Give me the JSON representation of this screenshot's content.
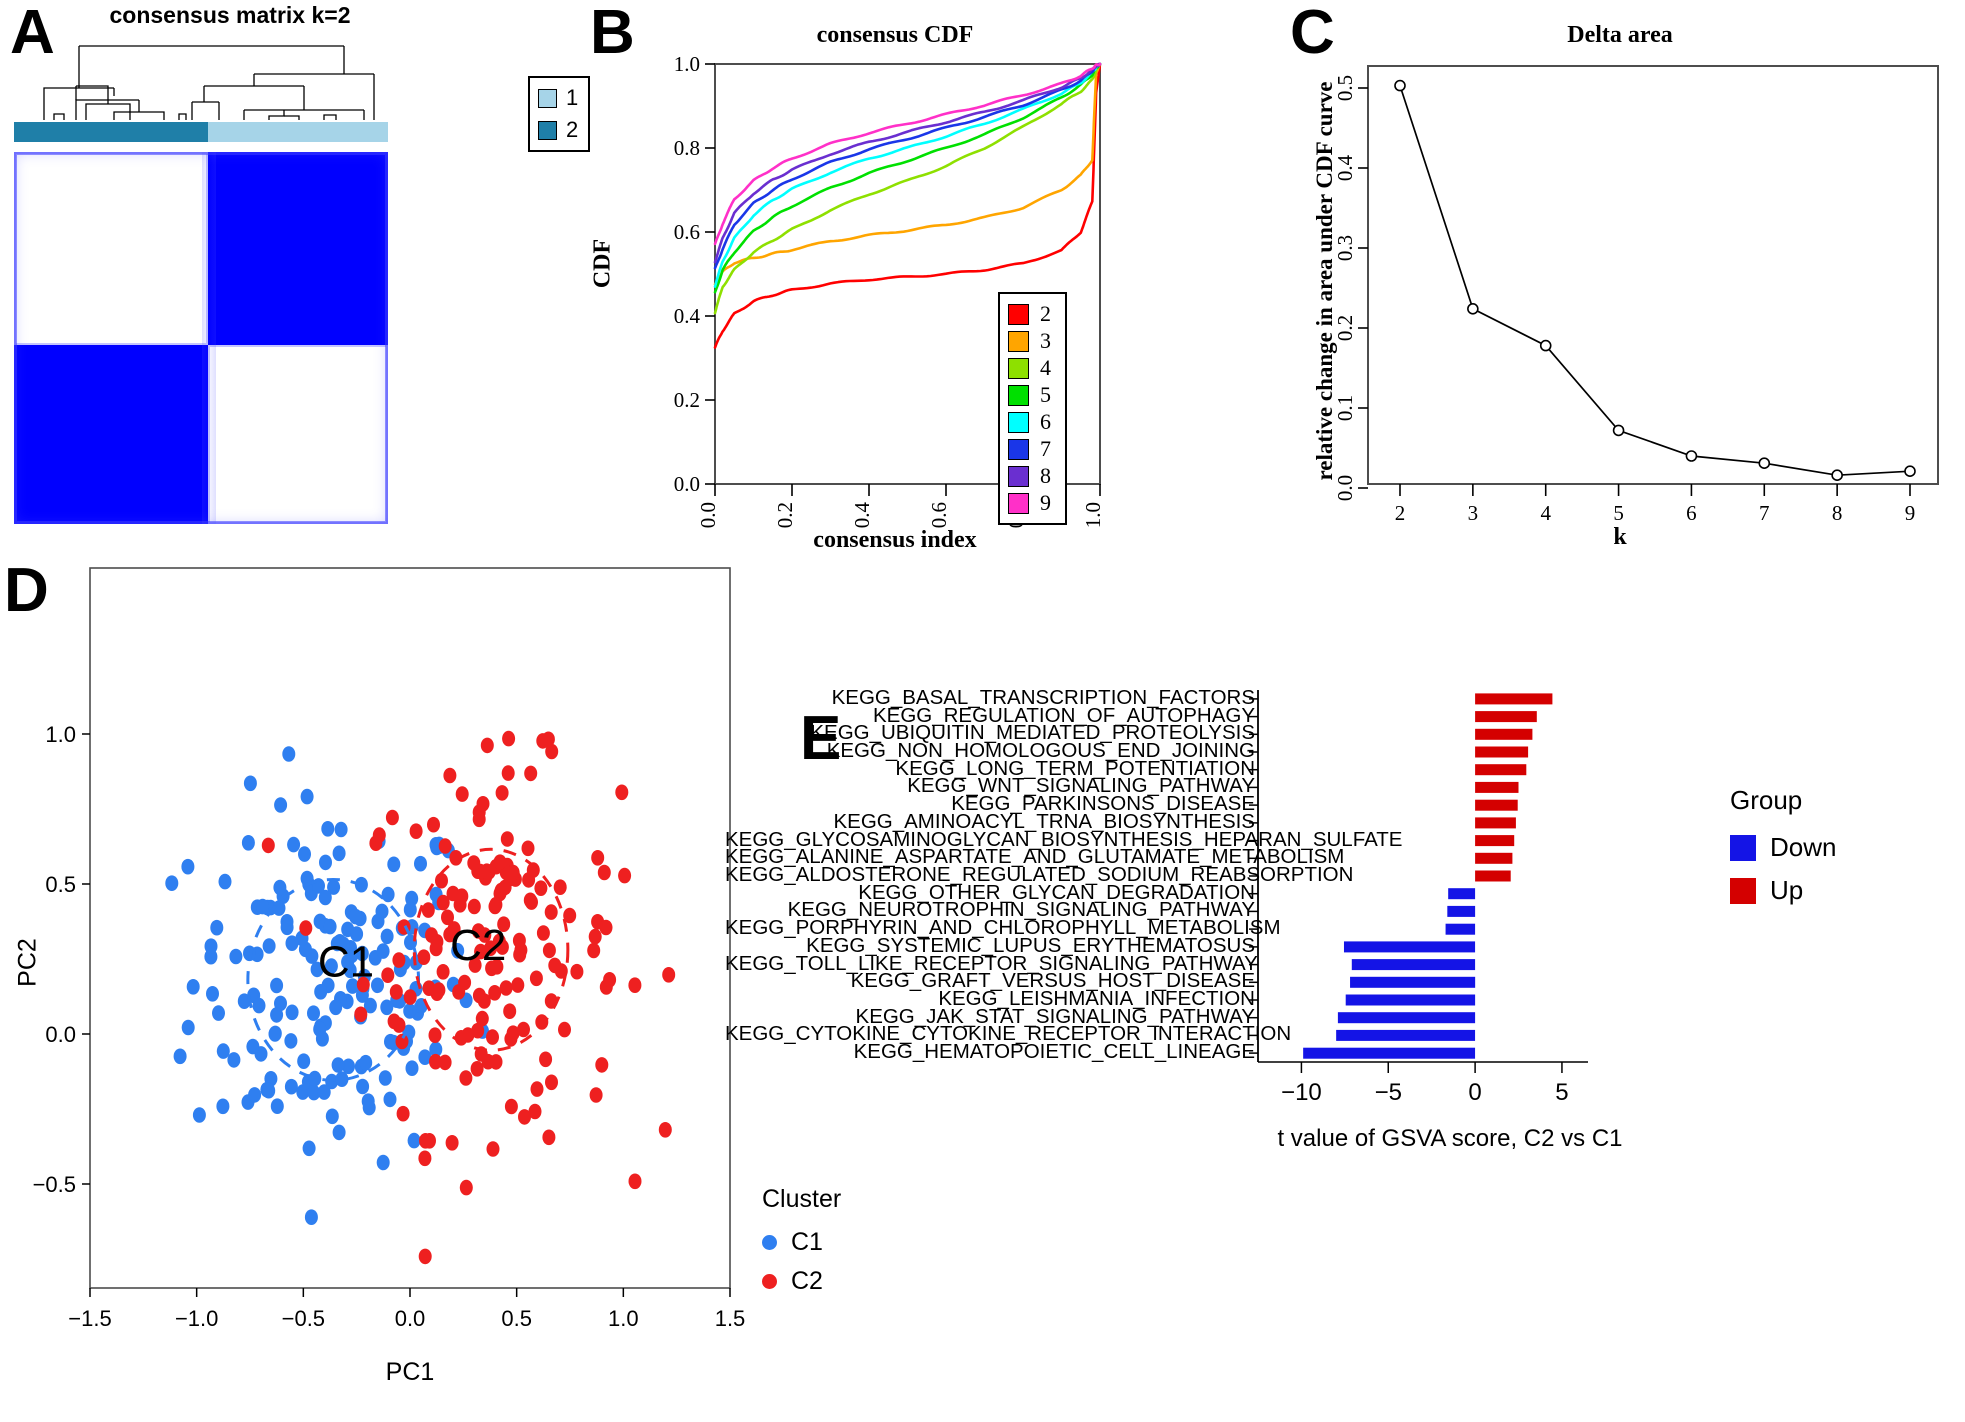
{
  "panels": {
    "a": {
      "letter": "A",
      "title": "consensus matrix k=2",
      "legend": [
        {
          "label": "1",
          "color": "#a6d4e8"
        },
        {
          "label": "2",
          "color": "#1f7fa8"
        }
      ]
    },
    "b": {
      "letter": "B",
      "title": "consensus CDF",
      "xlabel": "consensus index",
      "ylabel": "CDF"
    },
    "c": {
      "letter": "C",
      "title": "Delta area",
      "xlabel": "k",
      "ylabel": "relative change in area under CDF curve"
    },
    "d": {
      "letter": "D",
      "xlabel": "PC1",
      "ylabel": "PC2",
      "legend_title": "Cluster",
      "cluster_labels": [
        "C1",
        "C2"
      ],
      "legend": [
        {
          "label": "C1",
          "color": "#2f7ff0"
        },
        {
          "label": "C2",
          "color": "#ee2020"
        }
      ]
    },
    "e": {
      "letter": "E",
      "xlabel": "t value of GSVA score, C2 vs C1",
      "legend_title": "Group",
      "legend": [
        {
          "label": "Down",
          "color": "#1414e6"
        },
        {
          "label": "Up",
          "color": "#d40000"
        }
      ]
    }
  },
  "chart_data": [
    {
      "id": "panel_a",
      "type": "heatmap",
      "title": "consensus matrix k=2",
      "description": "Consensus matrix for k=2 with dendrogram; two blocks, cluster1 light blue and cluster2 dark blue",
      "legend_entries": [
        "1",
        "2"
      ],
      "colors": {
        "cluster1": "#a6d4e8",
        "cluster2": "#1f7fa8",
        "matrix_high": "#0000ff",
        "matrix_low": "#ffffff"
      },
      "split_fraction": 0.52
    },
    {
      "id": "panel_b",
      "type": "line",
      "title": "consensus CDF",
      "xlabel": "consensus index",
      "ylabel": "CDF",
      "xlim": [
        0,
        1
      ],
      "ylim": [
        0,
        1
      ],
      "xticks": [
        0.0,
        0.2,
        0.4,
        0.6,
        0.8,
        1.0
      ],
      "yticks": [
        0.0,
        0.2,
        0.4,
        0.6,
        0.8,
        1.0
      ],
      "grid": false,
      "legend_position": "bottom-right",
      "x": [
        0.0,
        0.02,
        0.05,
        0.1,
        0.15,
        0.2,
        0.3,
        0.4,
        0.5,
        0.6,
        0.7,
        0.8,
        0.9,
        0.95,
        0.98,
        0.99,
        1.0
      ],
      "series": [
        {
          "name": "2",
          "color": "#ff0000",
          "values": [
            0.325,
            0.365,
            0.405,
            0.435,
            0.45,
            0.462,
            0.477,
            0.487,
            0.493,
            0.5,
            0.51,
            0.525,
            0.556,
            0.6,
            0.672,
            0.93,
            1.0
          ]
        },
        {
          "name": "3",
          "color": "#ffa500",
          "values": [
            0.475,
            0.505,
            0.527,
            0.538,
            0.548,
            0.558,
            0.578,
            0.592,
            0.604,
            0.617,
            0.634,
            0.658,
            0.7,
            0.735,
            0.772,
            0.98,
            1.0
          ]
        },
        {
          "name": "4",
          "color": "#8ee000",
          "values": [
            0.408,
            0.47,
            0.51,
            0.552,
            0.58,
            0.606,
            0.652,
            0.69,
            0.722,
            0.757,
            0.8,
            0.85,
            0.905,
            0.935,
            0.962,
            0.985,
            1.0
          ]
        },
        {
          "name": "5",
          "color": "#00e000",
          "values": [
            0.455,
            0.51,
            0.552,
            0.602,
            0.635,
            0.662,
            0.705,
            0.74,
            0.77,
            0.8,
            0.832,
            0.872,
            0.92,
            0.95,
            0.975,
            0.99,
            1.0
          ]
        },
        {
          "name": "6",
          "color": "#00ffff",
          "values": [
            0.472,
            0.53,
            0.585,
            0.64,
            0.676,
            0.702,
            0.742,
            0.775,
            0.8,
            0.828,
            0.858,
            0.892,
            0.93,
            0.955,
            0.98,
            0.992,
            1.0
          ]
        },
        {
          "name": "7",
          "color": "#1a36e8",
          "values": [
            0.512,
            0.56,
            0.618,
            0.668,
            0.7,
            0.726,
            0.766,
            0.797,
            0.822,
            0.848,
            0.874,
            0.902,
            0.938,
            0.96,
            0.983,
            0.994,
            1.0
          ]
        },
        {
          "name": "8",
          "color": "#6a2fd0",
          "values": [
            0.53,
            0.585,
            0.645,
            0.692,
            0.724,
            0.748,
            0.786,
            0.814,
            0.838,
            0.862,
            0.886,
            0.913,
            0.945,
            0.966,
            0.986,
            0.995,
            1.0
          ]
        },
        {
          "name": "9",
          "color": "#ff30c8",
          "values": [
            0.57,
            0.62,
            0.678,
            0.722,
            0.752,
            0.775,
            0.81,
            0.836,
            0.858,
            0.88,
            0.902,
            0.926,
            0.953,
            0.972,
            0.99,
            0.997,
            1.0
          ]
        }
      ]
    },
    {
      "id": "panel_c",
      "type": "line",
      "title": "Delta area",
      "xlabel": "k",
      "ylabel": "relative change in area under CDF curve",
      "xlim": [
        2,
        9
      ],
      "ylim": [
        0,
        0.52
      ],
      "xticks": [
        2,
        3,
        4,
        5,
        6,
        7,
        8,
        9
      ],
      "yticks": [
        0.0,
        0.1,
        0.2,
        0.3,
        0.4,
        0.5
      ],
      "grid": false,
      "categories": [
        2,
        3,
        4,
        5,
        6,
        7,
        8,
        9
      ],
      "values": [
        0.503,
        0.224,
        0.178,
        0.072,
        0.04,
        0.031,
        0.016,
        0.021
      ],
      "marker": "open-circle"
    },
    {
      "id": "panel_d",
      "type": "scatter",
      "xlabel": "PC1",
      "ylabel": "PC2",
      "xlim": [
        -1.5,
        1.5
      ],
      "ylim": [
        -0.95,
        1.2
      ],
      "xticks": [
        -1.5,
        -1.0,
        -0.5,
        0.0,
        0.5,
        1.0,
        1.5
      ],
      "yticks": [
        -0.5,
        0.0,
        0.5,
        1.0
      ],
      "grid": false,
      "legend_title": "Cluster",
      "legend_position": "right",
      "annotations": [
        "C1",
        "C2"
      ],
      "series": [
        {
          "name": "C1",
          "color": "#2f7ff0",
          "n_points": 172,
          "centroid": [
            -0.36,
            -0.03
          ],
          "ellipse": {
            "cx": -0.36,
            "cy": -0.03,
            "rx": 0.4,
            "ry": 0.3,
            "style": "dashed"
          }
        },
        {
          "name": "C2",
          "color": "#ee2020",
          "n_points": 155,
          "centroid": [
            0.38,
            0.06
          ],
          "ellipse": {
            "cx": 0.38,
            "cy": 0.06,
            "rx": 0.36,
            "ry": 0.3,
            "style": "dashed"
          }
        }
      ]
    },
    {
      "id": "panel_e",
      "type": "bar",
      "orientation": "horizontal",
      "xlabel": "t value of GSVA score, C2 vs C1",
      "ylabel": "",
      "xlim": [
        -12.5,
        6.5
      ],
      "xticks": [
        -10,
        -5,
        0,
        5
      ],
      "grid": false,
      "legend_title": "Group",
      "legend_entries": [
        {
          "label": "Down",
          "color": "#1414e6"
        },
        {
          "label": "Up",
          "color": "#d40000"
        }
      ],
      "categories": [
        "KEGG_BASAL_TRANSCRIPTION_FACTORS",
        "KEGG_REGULATION_OF_AUTOPHAGY",
        "KEGG_UBIQUITIN_MEDIATED_PROTEOLYSIS",
        "KEGG_NON_HOMOLOGOUS_END_JOINING",
        "KEGG_LONG_TERM_POTENTIATION",
        "KEGG_WNT_SIGNALING_PATHWAY",
        "KEGG_PARKINSONS_DISEASE",
        "KEGG_AMINOACYL_TRNA_BIOSYNTHESIS",
        "KEGG_GLYCOSAMINOGLYCAN_BIOSYNTHESIS_HEPARAN_SULFATE",
        "KEGG_ALANINE_ASPARTATE_AND_GLUTAMATE_METABOLISM",
        "KEGG_ALDOSTERONE_REGULATED_SODIUM_REABSORPTION",
        "KEGG_OTHER_GLYCAN_DEGRADATION",
        "KEGG_NEUROTROPHIN_SIGNALING_PATHWAY",
        "KEGG_PORPHYRIN_AND_CHLOROPHYLL_METABOLISM",
        "KEGG_SYSTEMIC_LUPUS_ERYTHEMATOSUS",
        "KEGG_TOLL_LIKE_RECEPTOR_SIGNALING_PATHWAY",
        "KEGG_GRAFT_VERSUS_HOST_DISEASE",
        "KEGG_LEISHMANIA_INFECTION",
        "KEGG_JAK_STAT_SIGNALING_PATHWAY",
        "KEGG_CYTOKINE_CYTOKINE_RECEPTOR_INTERACTION",
        "KEGG_HEMATOPOIETIC_CELL_LINEAGE"
      ],
      "values": [
        4.45,
        3.55,
        3.3,
        3.05,
        2.95,
        2.5,
        2.45,
        2.35,
        2.25,
        2.15,
        2.05,
        -1.55,
        -1.6,
        -1.7,
        -7.55,
        -7.1,
        -7.2,
        -7.45,
        -7.9,
        -8.0,
        -9.9
      ],
      "groups": [
        "Up",
        "Up",
        "Up",
        "Up",
        "Up",
        "Up",
        "Up",
        "Up",
        "Up",
        "Up",
        "Up",
        "Down",
        "Down",
        "Down",
        "Down",
        "Down",
        "Down",
        "Down",
        "Down",
        "Down",
        "Down"
      ]
    }
  ]
}
